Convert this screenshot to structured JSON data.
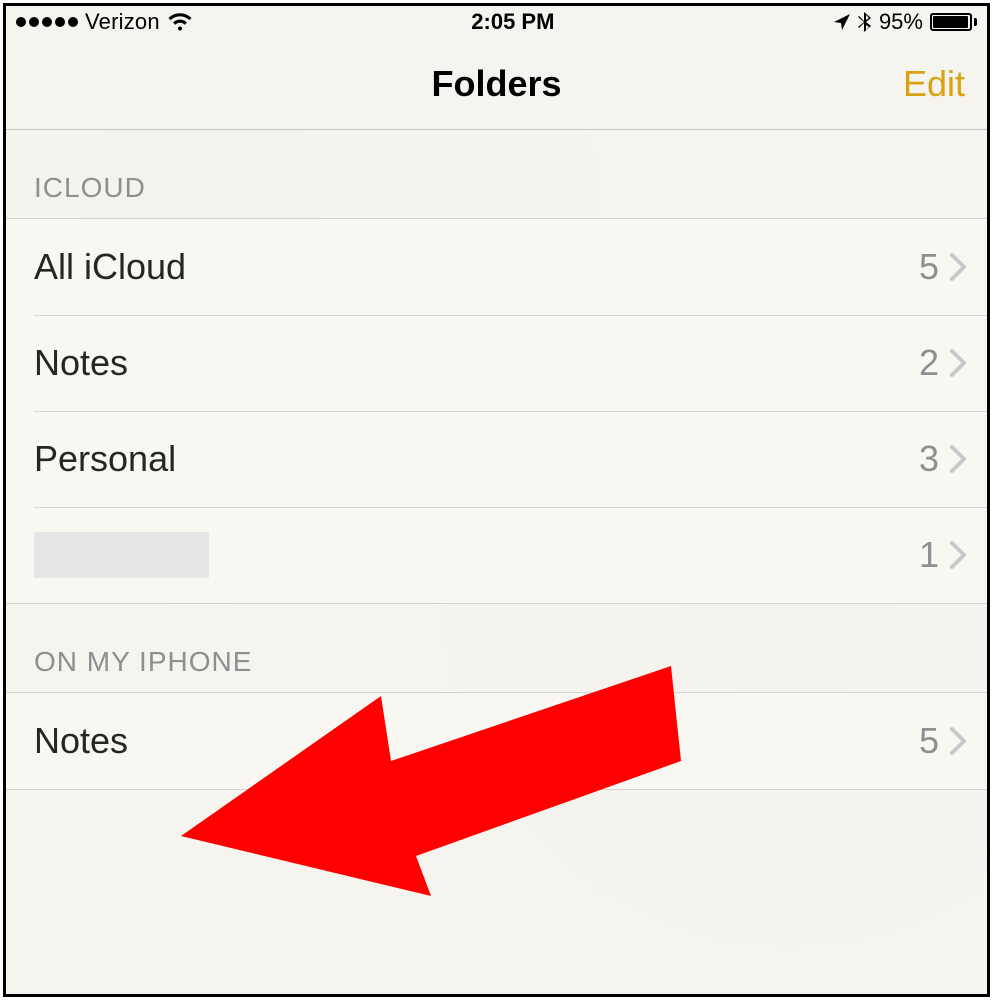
{
  "status": {
    "carrier": "Verizon",
    "time": "2:05 PM",
    "battery_pct": "95%"
  },
  "nav": {
    "title": "Folders",
    "edit_label": "Edit"
  },
  "sections": {
    "icloud": {
      "header": "ICLOUD",
      "rows": {
        "all_icloud": {
          "label": "All iCloud",
          "count": "5"
        },
        "notes": {
          "label": "Notes",
          "count": "2"
        },
        "personal": {
          "label": "Personal",
          "count": "3"
        },
        "redacted": {
          "label": "",
          "count": "1"
        }
      }
    },
    "on_my_iphone": {
      "header": "ON MY IPHONE",
      "rows": {
        "notes": {
          "label": "Notes",
          "count": "5"
        }
      }
    }
  },
  "colors": {
    "accent": "#d9a213",
    "annotation": "#ff0000"
  }
}
